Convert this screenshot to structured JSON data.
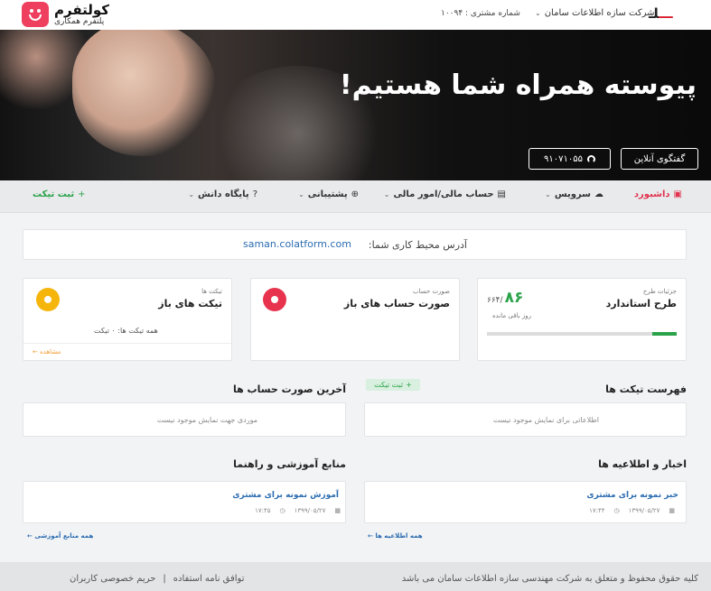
{
  "topbar": {
    "colatform": {
      "name": "کولتفرم",
      "tagline": "پلتفرم همکاری"
    },
    "account_label": "شماره مشتری : ۱۰۰۹۴",
    "company": "شرکت سازه اطلاعات سامان",
    "company_logo": "سامان"
  },
  "hero": {
    "title": "پیوسته همراه شما هستیم!",
    "chat_label": "گفتگوی آنلاین",
    "phone_label": "۹۱۰۷۱۰۵۵"
  },
  "nav": {
    "dashboard": "داشبورد",
    "service": "سرویس",
    "finance": "حساب مالی/امور مالی",
    "support": "پشتیبانی",
    "knowledge": "پایگاه دانش",
    "new_ticket": "ثبت تیکت"
  },
  "workspace": {
    "label": "آدرس محیط کاری شما:",
    "url": "saman.colatform.com"
  },
  "plan_card": {
    "label": "جزئیات طرح",
    "title": "طرح استاندارد",
    "days_left": "۸۶",
    "days_total": "/۶۶۴",
    "days_caption": "روز باقی مانده",
    "progress": 0.13,
    "progress_color": "#2aa34a"
  },
  "invoice_card": {
    "label": "صورت حساب",
    "title": "صورت حساب های باز",
    "icon_color": "#e8334f"
  },
  "ticket_card": {
    "label": "تیکت ها",
    "title": "تیکت های باز",
    "all_count": "همه تیکت ها: ۰ تیکت",
    "view_link": "مشاهده",
    "icon_color": "#f5b50a"
  },
  "tickets_section": {
    "title": "فهرست تیکت ها",
    "empty": "اطلاعاتی برای نمایش موجود نیست",
    "new_ticket": "ثبت تیکت"
  },
  "invoices_section": {
    "title": "آخرین صورت حساب ها",
    "empty": "موردی جهت نمایش موجود نیست"
  },
  "news_section": {
    "title": "اخبار و اطلاعیه ها",
    "post_title": "خبر نمونه برای مشتری",
    "post_date": "۱۳۹۹/۰۵/۲۷",
    "post_time": "۱۷:۴۴",
    "all_link": "همه اطلاعیه ها"
  },
  "learning_section": {
    "title": "منابع آموزشی و راهنما",
    "post_title": "آموزش نمونه برای مشتری",
    "post_date": "۱۳۹۹/۰۵/۲۷",
    "post_time": "۱۷:۴۵",
    "all_link": "همه منابع آموزشی"
  },
  "footer": {
    "copyright": "کلیه حقوق محفوظ و متعلق به شرکت مهندسی سازه اطلاعات سامان می باشد",
    "terms": "توافق نامه استفاده",
    "privacy": "حریم خصوصی کاربران",
    "separator": "|"
  }
}
